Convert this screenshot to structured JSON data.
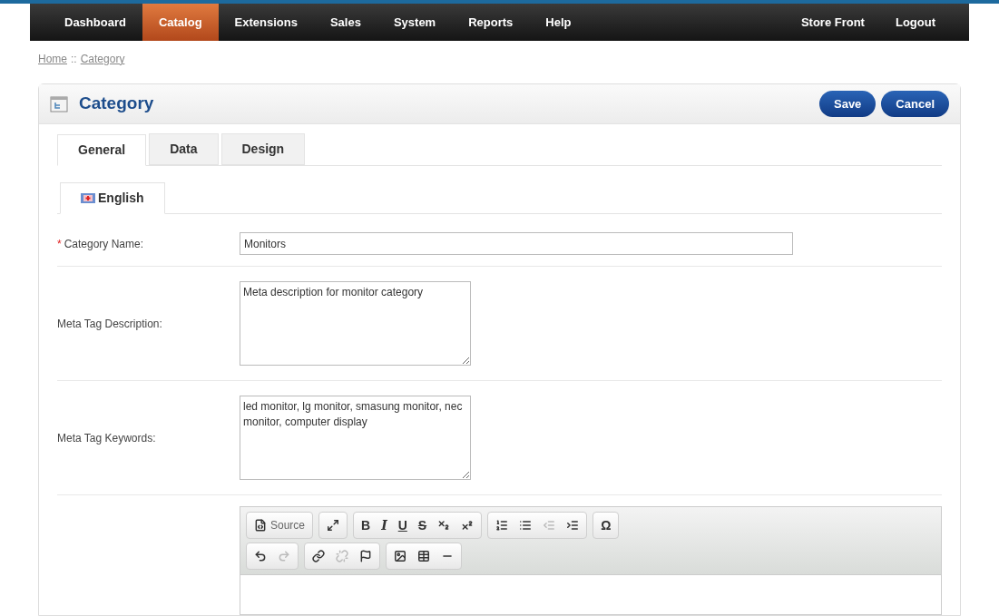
{
  "nav": {
    "left": [
      {
        "label": "Dashboard",
        "selected": false
      },
      {
        "label": "Catalog",
        "selected": true
      },
      {
        "label": "Extensions",
        "selected": false
      },
      {
        "label": "Sales",
        "selected": false
      },
      {
        "label": "System",
        "selected": false
      },
      {
        "label": "Reports",
        "selected": false
      },
      {
        "label": "Help",
        "selected": false
      }
    ],
    "right": [
      {
        "label": "Store Front",
        "selected": false
      },
      {
        "label": "Logout",
        "selected": false
      }
    ]
  },
  "breadcrumb": [
    {
      "label": "Home"
    },
    {
      "label": "::",
      "kind": "separator"
    },
    {
      "label": "Category"
    }
  ],
  "panel": {
    "title": "Category",
    "buttons": [
      "Save",
      "Cancel"
    ],
    "tabs": [
      {
        "label": "General",
        "selected": true
      },
      {
        "label": "Data",
        "selected": false
      },
      {
        "label": "Design",
        "selected": false
      }
    ],
    "languages": [
      {
        "label": "English",
        "selected": true
      }
    ],
    "fields": [
      {
        "marker": "*",
        "label": "Category Name:",
        "kind": "input",
        "value": "Monitors"
      },
      {
        "label": "Meta Tag Description:",
        "kind": "textarea",
        "value": "Meta description for monitor category"
      },
      {
        "label": "Meta Tag Keywords:",
        "kind": "textarea",
        "value": "led monitor, lg monitor, smasung monitor, nec monitor, computer display"
      }
    ],
    "editor_toolbar": [
      [
        [
          {
            "kind": "icon",
            "text": "Source",
            "disabled": false
          }
        ],
        [
          {
            "kind": "icon",
            "disabled": false
          }
        ],
        [
          {
            "kind": "text",
            "text": "B",
            "disabled": false
          },
          {
            "kind": "text",
            "text": "I",
            "disabled": false
          },
          {
            "kind": "text",
            "text": "U",
            "disabled": false
          },
          {
            "kind": "text",
            "text": "S",
            "disabled": false
          },
          {
            "kind": "icon",
            "disabled": false
          },
          {
            "kind": "icon",
            "disabled": false
          }
        ],
        [
          {
            "kind": "icon",
            "disabled": false
          },
          {
            "kind": "icon",
            "disabled": false
          },
          {
            "kind": "icon",
            "disabled": true
          },
          {
            "kind": "icon",
            "disabled": false
          }
        ],
        [
          {
            "kind": "text",
            "text": "Ω",
            "disabled": false
          }
        ]
      ],
      [
        [
          {
            "kind": "icon",
            "disabled": false
          },
          {
            "kind": "icon",
            "disabled": true
          }
        ],
        [
          {
            "kind": "icon",
            "disabled": false
          },
          {
            "kind": "icon",
            "disabled": true
          },
          {
            "kind": "icon",
            "disabled": false
          }
        ],
        [
          {
            "kind": "icon",
            "disabled": false
          },
          {
            "kind": "icon",
            "disabled": false
          },
          {
            "kind": "icon",
            "disabled": false
          }
        ]
      ]
    ]
  }
}
